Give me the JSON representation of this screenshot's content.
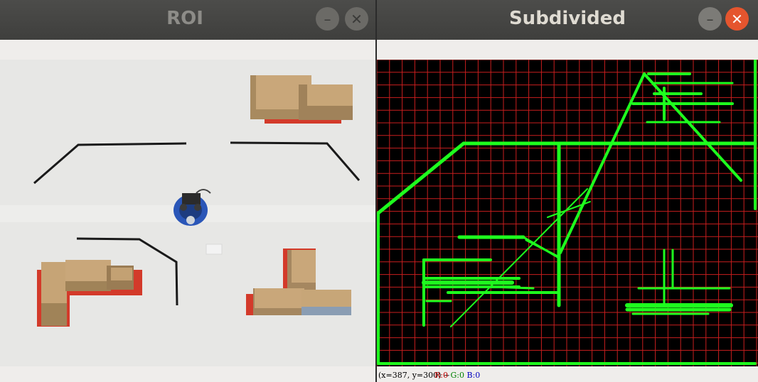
{
  "windows": {
    "roi": {
      "title": "ROI"
    },
    "subdivided": {
      "title": "Subdivided"
    }
  },
  "controls": {
    "minimize_glyph": "–",
    "close_glyph": "✕"
  },
  "statusbar": {
    "coords": "(x=387, y=300) ~",
    "r": "R:0",
    "g": "G:0",
    "b": "B:0"
  },
  "colors": {
    "grid": "#c81e1e",
    "path": "#1eff1e",
    "close_active": "#e5552e",
    "floor": "#e6e6e4"
  },
  "icons": [
    "minimize-icon",
    "close-icon"
  ]
}
